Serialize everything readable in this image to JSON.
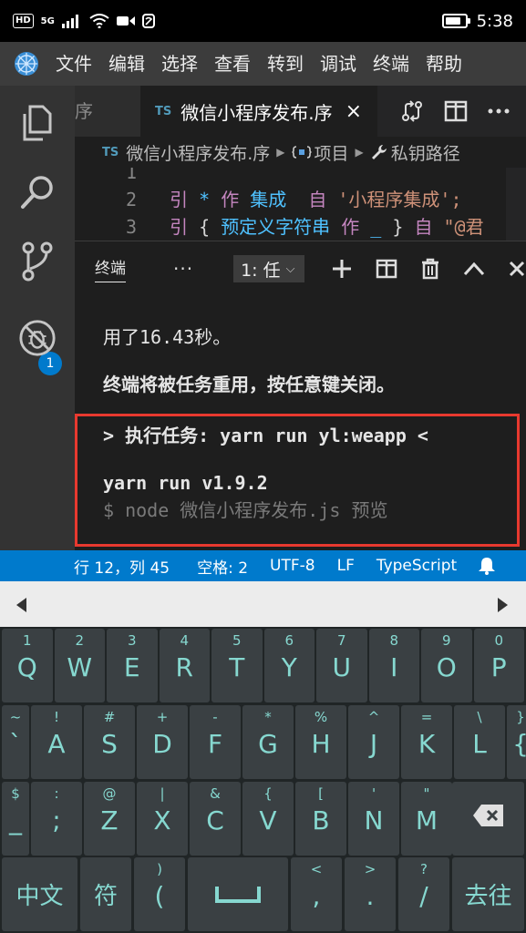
{
  "statusbar": {
    "hd_badge": "HD",
    "net_label": "5G",
    "time": "5:38",
    "battery_fraction": 0.8
  },
  "menubar": {
    "items": [
      "文件",
      "编辑",
      "选择",
      "查看",
      "转到",
      "调试",
      "终端",
      "帮助"
    ]
  },
  "activitybar": {
    "scm_badge": "1"
  },
  "tabs": {
    "prev_tab_label": "序",
    "active_tab_lang": "TS",
    "active_tab_label": "微信小程序发布.序",
    "close_glyph": "×"
  },
  "breadcrumb": {
    "lang": "TS",
    "file": "微信小程序发布.序",
    "item2": "项目",
    "item3": "私钥路径"
  },
  "code": {
    "line1_num": "1",
    "line2": {
      "num": "2",
      "kw": "引",
      "star": "*",
      "as": "作",
      "name": "集成",
      "from": "自",
      "str": "'小程序集成';"
    },
    "line3": {
      "num": "3",
      "kw": "引",
      "brace_open": "{",
      "name": "预定义字符串",
      "as": "作",
      "alias": "_",
      "brace_close": "}",
      "from": "自",
      "str": "\"@君"
    }
  },
  "panel": {
    "title": "终端",
    "more": "···",
    "terminal_select": "1: 任"
  },
  "terminal": {
    "line1": "用了16.43秒。",
    "line2": "终端将被任务重用，按任意键关闭。",
    "line3": "> 执行任务:  yarn run yl:weapp <",
    "line4": "yarn run v1.9.2",
    "line5": "$ node 微信小程序发布.js 预览"
  },
  "vsstatus": {
    "position": "行 12，列 45",
    "spaces": "空格: 2",
    "encoding": "UTF-8",
    "eol": "LF",
    "language": "TypeScript"
  },
  "keyboard": {
    "row1": [
      {
        "top": "1",
        "main": "Q"
      },
      {
        "top": "2",
        "main": "W"
      },
      {
        "top": "3",
        "main": "E"
      },
      {
        "top": "4",
        "main": "R"
      },
      {
        "top": "5",
        "main": "T"
      },
      {
        "top": "6",
        "main": "Y"
      },
      {
        "top": "7",
        "main": "U"
      },
      {
        "top": "8",
        "main": "I"
      },
      {
        "top": "9",
        "main": "O"
      },
      {
        "top": "0",
        "main": "P"
      }
    ],
    "row2": [
      {
        "top": "~",
        "main": "`"
      },
      {
        "top": "!",
        "main": "A"
      },
      {
        "top": "#",
        "main": "S"
      },
      {
        "top": "+",
        "main": "D"
      },
      {
        "top": "-",
        "main": "F"
      },
      {
        "top": "*",
        "main": "G"
      },
      {
        "top": "%",
        "main": "H"
      },
      {
        "top": "^",
        "main": "J"
      },
      {
        "top": "=",
        "main": "K"
      },
      {
        "top": "\\",
        "main": "L"
      },
      {
        "top": "}",
        "main": "{"
      }
    ],
    "row3": [
      {
        "top": "$",
        "main": "_"
      },
      {
        "top": ":",
        "main": ";"
      },
      {
        "top": "@",
        "main": "Z"
      },
      {
        "top": "|",
        "main": "X"
      },
      {
        "top": "&",
        "main": "C"
      },
      {
        "top": "{",
        "main": "V"
      },
      {
        "top": "[",
        "main": "B"
      },
      {
        "top": "'",
        "main": "N"
      },
      {
        "top": "\"",
        "main": "M"
      }
    ],
    "row4": {
      "lang": "中文",
      "symbol": "符",
      "paren_top": ")",
      "paren_main": "(",
      "lt": "<",
      "comma": ",",
      "gt": ">",
      "period": ".",
      "question": "?",
      "slash": "/",
      "go": "去往"
    }
  }
}
